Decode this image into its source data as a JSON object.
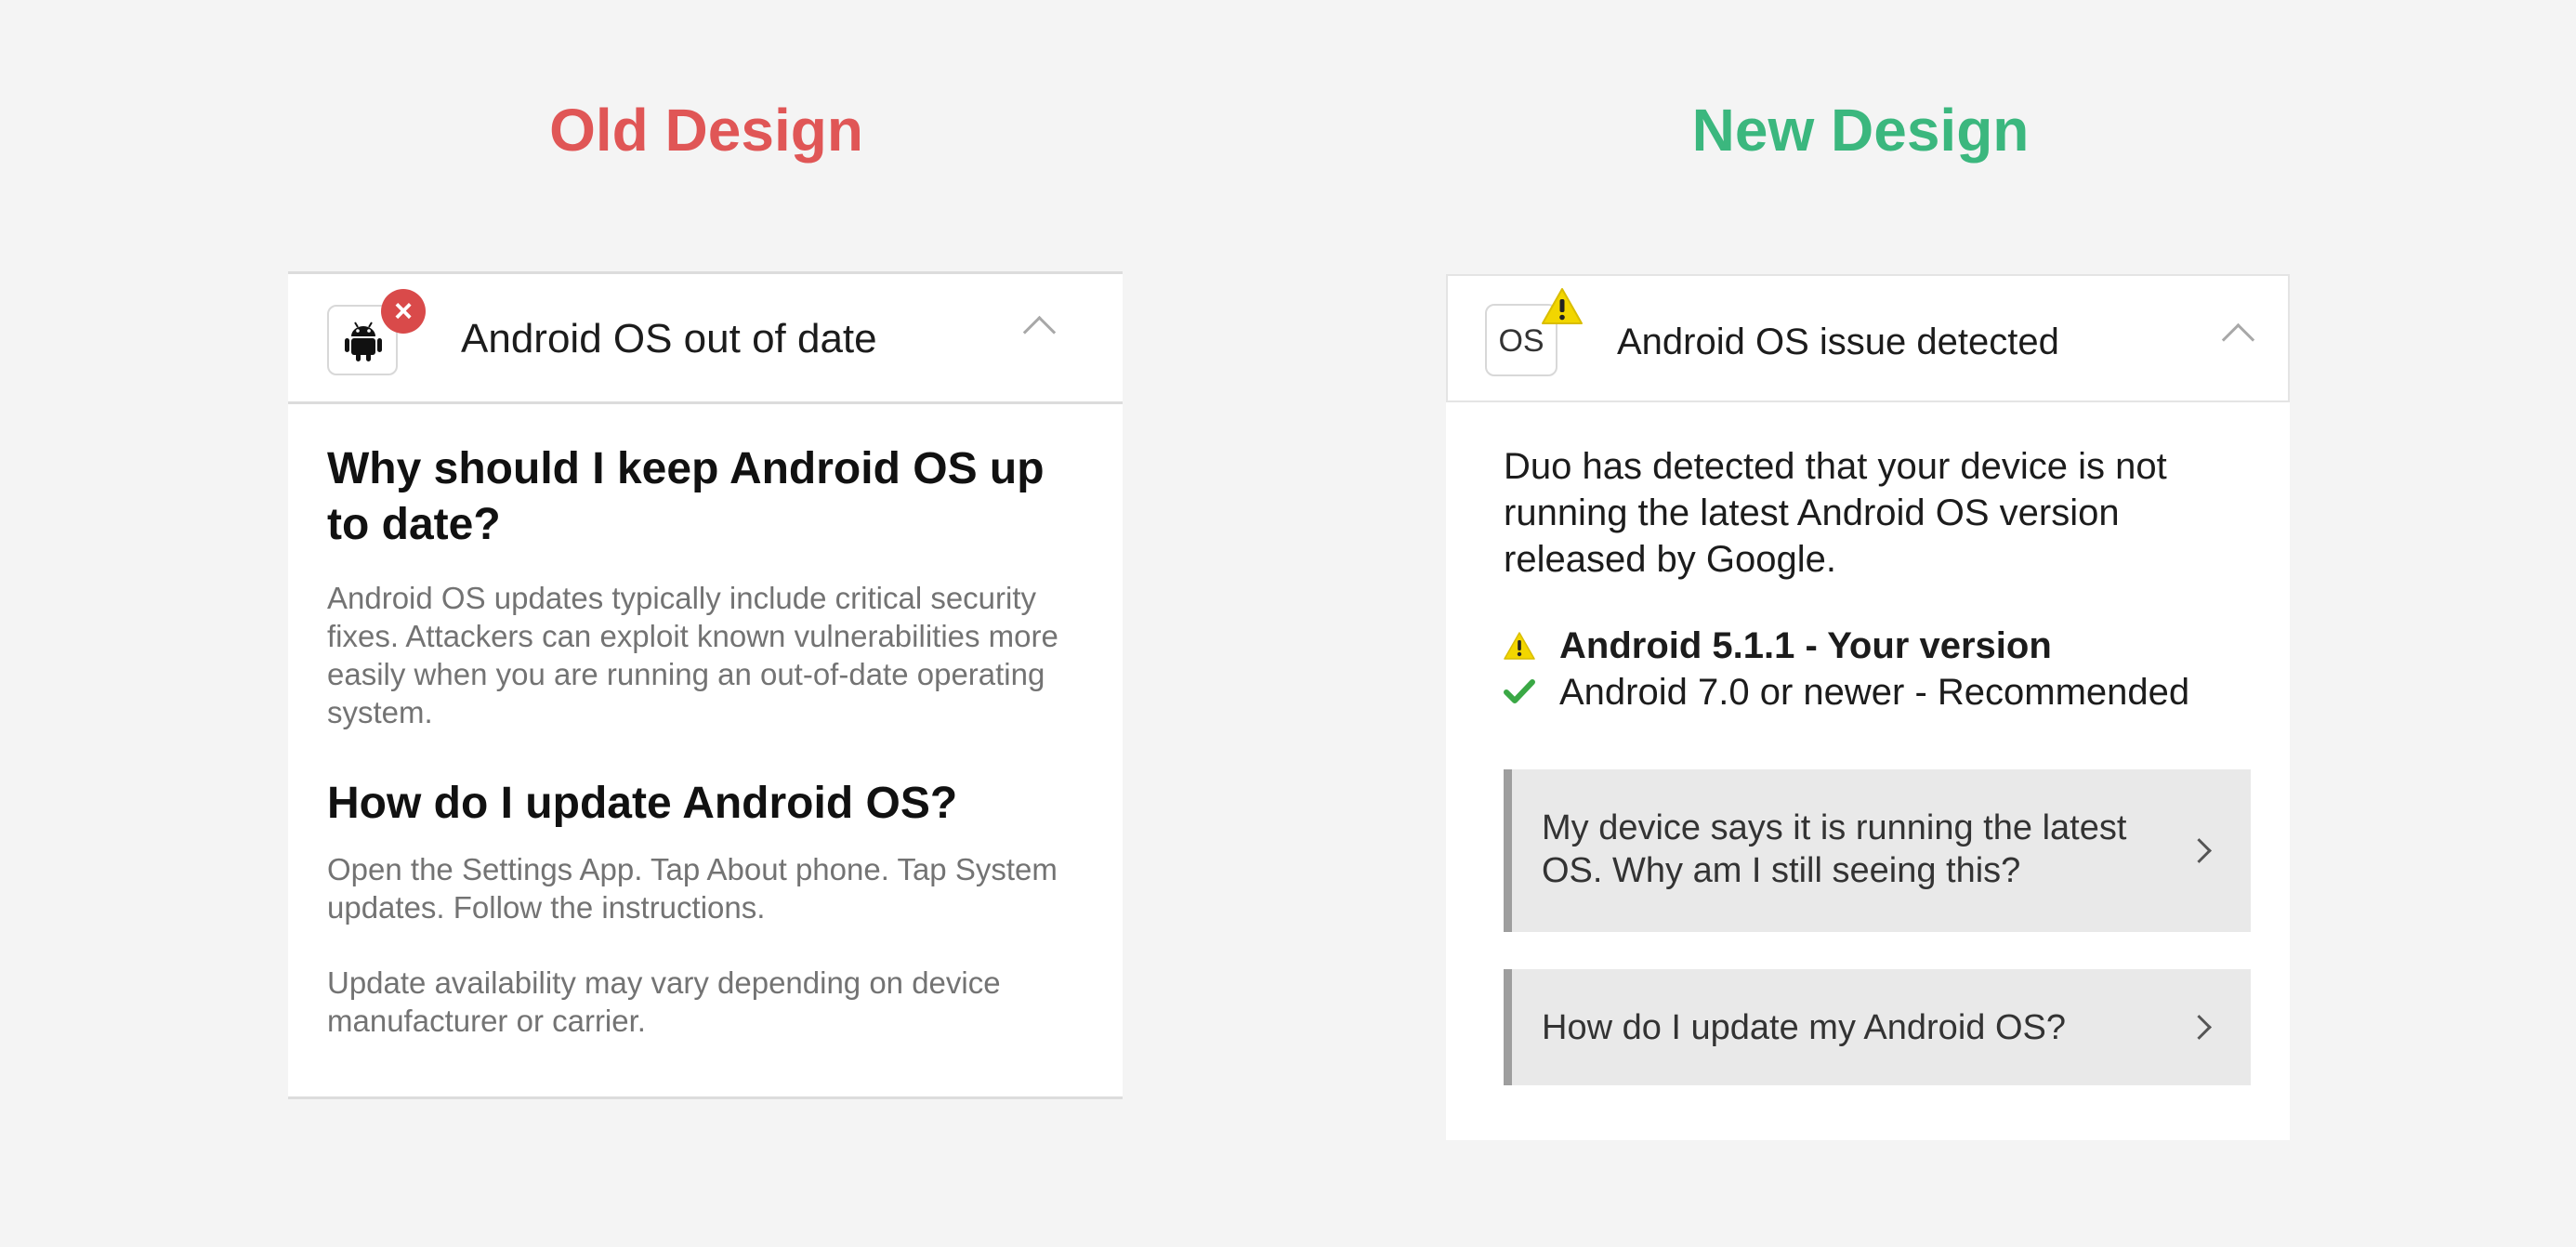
{
  "headings": {
    "old": "Old Design",
    "new": "New Design"
  },
  "colors": {
    "old_heading": "#e05656",
    "new_heading": "#3bb77e",
    "error_badge": "#d94a4a",
    "warning": "#f2d600",
    "check": "#3aa845"
  },
  "old_card": {
    "title": "Android OS out of date",
    "icon": "android-icon",
    "badge": "×",
    "q1": "Why should I keep Android OS up to date?",
    "p1": "Android OS updates typically include critical security fixes. Attackers can exploit known vulnerabilities more easily when you are running an out-of-date operating system.",
    "q2": "How do I update Android OS?",
    "p2": "Open the Settings App. Tap About phone. Tap System updates. Follow the instructions.",
    "p3": "Update availability may vary depending on device manufacturer or carrier."
  },
  "new_card": {
    "icon_text": "OS",
    "title": "Android OS issue detected",
    "intro": "Duo has detected that your device is not running the latest Android OS version released by Google.",
    "current_version": "Android 5.1.1 - Your version",
    "recommended_version": "Android 7.0 or newer - Recommended",
    "faq": [
      "My device says it is running the latest OS. Why am I still seeing this?",
      "How do I update my Android OS?"
    ]
  }
}
